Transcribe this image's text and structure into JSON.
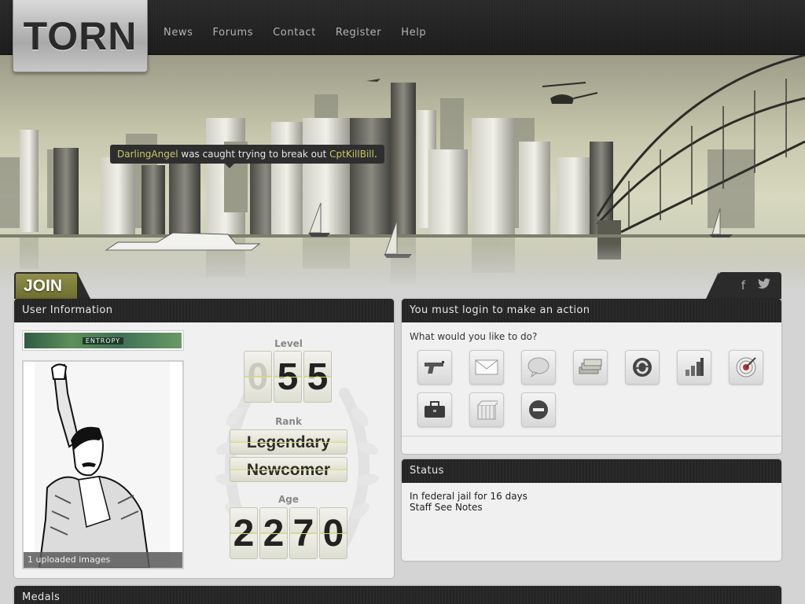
{
  "header": {
    "logo": "TORN",
    "nav": [
      "News",
      "Forums",
      "Contact",
      "Register",
      "Help"
    ]
  },
  "banner": {
    "event": {
      "user1": "DarlingAngel",
      "text": " was caught trying to break out ",
      "user2": "CptKillBill",
      "end": "."
    }
  },
  "join": {
    "label": "JOIN"
  },
  "social": {
    "facebook": "f",
    "twitter": "t"
  },
  "user_info": {
    "title": "User Information",
    "faction_tag": "ENTROPY",
    "avatar_caption": "1 uploaded images",
    "level_label": "Level",
    "level_digits": [
      "0",
      "5",
      "5"
    ],
    "rank_label": "Rank",
    "rank_line1": "Legendary",
    "rank_line2": "Newcomer",
    "age_label": "Age",
    "age_digits": [
      "2",
      "2",
      "7",
      "0"
    ]
  },
  "actions": {
    "title": "You must login to make an action",
    "prompt": "What would you like to do?",
    "icons": [
      "gun-icon",
      "mail-icon",
      "chat-bubble-icon",
      "money-icon",
      "trade-icon",
      "stats-bars-icon",
      "target-icon",
      "briefcase-icon",
      "cage-icon",
      "no-entry-icon"
    ]
  },
  "status": {
    "title": "Status",
    "line1": "In federal jail for 16 days",
    "line2": "Staff See Notes"
  },
  "medals": {
    "title": "Medals"
  },
  "colors": {
    "accent": "#c7c76a",
    "join": "#7a7a38",
    "header": "#2a2a2a"
  }
}
